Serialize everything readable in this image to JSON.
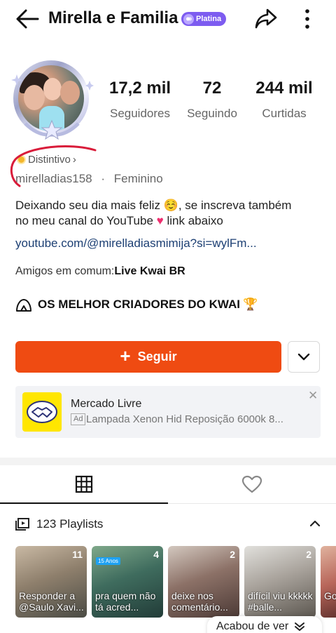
{
  "header": {
    "title": "Mirella e Familia",
    "badge_label": "Platina",
    "icons": {
      "back": "arrow-left-icon",
      "share": "share-icon",
      "more": "more-vertical-icon"
    }
  },
  "profile": {
    "stats": [
      {
        "value": "17,2 mil",
        "label": "Seguidores"
      },
      {
        "value": "72",
        "label": "Seguindo"
      },
      {
        "value": "244 mil",
        "label": "Curtidas"
      }
    ],
    "distintivo": "Distintivo",
    "username": "mirelladias158",
    "separator": "·",
    "gender": "Feminino",
    "bio_line1": "Deixando seu dia mais feliz ",
    "bio_emoji1": "☺️",
    "bio_line1b": ", se inscreva também",
    "bio_line2": "no meu canal do YouTube ",
    "bio_heart": "♥",
    "bio_line2b": " link abaixo",
    "link": "youtube.com/@mirelladiasmimija?si=wylFm...",
    "friends_prefix": "Amigos em comum:",
    "friends_name": "Live Kwai BR",
    "community_label": "OS MELHOR CRIADORES DO KWAI",
    "community_trophy": "🏆"
  },
  "actions": {
    "follow_label": "Seguir",
    "follow_plus": "+"
  },
  "ad": {
    "title": "Mercado Livre",
    "tag": "Ad",
    "text": "Lampada Xenon Hid Reposição 6000k 8...",
    "close": "✕"
  },
  "playlists": {
    "label": "123 Playlists",
    "items": [
      {
        "count": "11",
        "caption": "Responder a @Saulo Xavi..."
      },
      {
        "count": "4",
        "caption": "pra quem não tá acred..."
      },
      {
        "count": "2",
        "caption": "deixe nos comentário..."
      },
      {
        "count": "2",
        "caption": "difícil viu kkkkk #balle..."
      },
      {
        "count": "",
        "caption": "Go"
      }
    ],
    "badge_text": "15 Anos"
  },
  "toast": {
    "label": "Acabou de ver",
    "icon": "double-chevron-down-icon"
  },
  "colors": {
    "accent": "#ef4b12",
    "link": "#1c3f73",
    "badge": "#7d5cf0",
    "annotation": "#d91c3a"
  }
}
